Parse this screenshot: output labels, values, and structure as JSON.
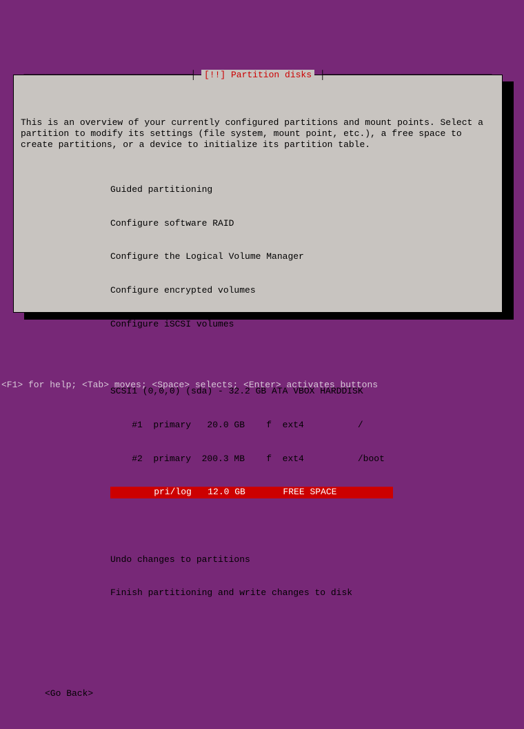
{
  "dialog": {
    "title_marker": "[!!]",
    "title": "Partition disks",
    "intro": "This is an overview of your currently configured partitions and mount points. Select a partition to modify its settings (file system, mount point, etc.), a free space to create partitions, or a device to initialize its partition table.",
    "menu": {
      "guided": "Guided partitioning",
      "raid": "Configure software RAID",
      "lvm": "Configure the Logical Volume Manager",
      "encrypted": "Configure encrypted volumes",
      "iscsi": "Configure iSCSI volumes"
    },
    "disk": {
      "header": "SCSI1 (0,0,0) (sda) - 32.2 GB ATA VBOX HARDDISK",
      "partitions": [
        "    #1  primary   20.0 GB    f  ext4          /",
        "    #2  primary  200.3 MB    f  ext4          /boot",
        "    pri/log   12.0 GB       FREE SPACE"
      ]
    },
    "undo": "Undo changes to partitions",
    "finish": "Finish partitioning and write changes to disk",
    "go_back": "<Go Back>"
  },
  "footer": "<F1> for help; <Tab> moves; <Space> selects; <Enter> activates buttons"
}
